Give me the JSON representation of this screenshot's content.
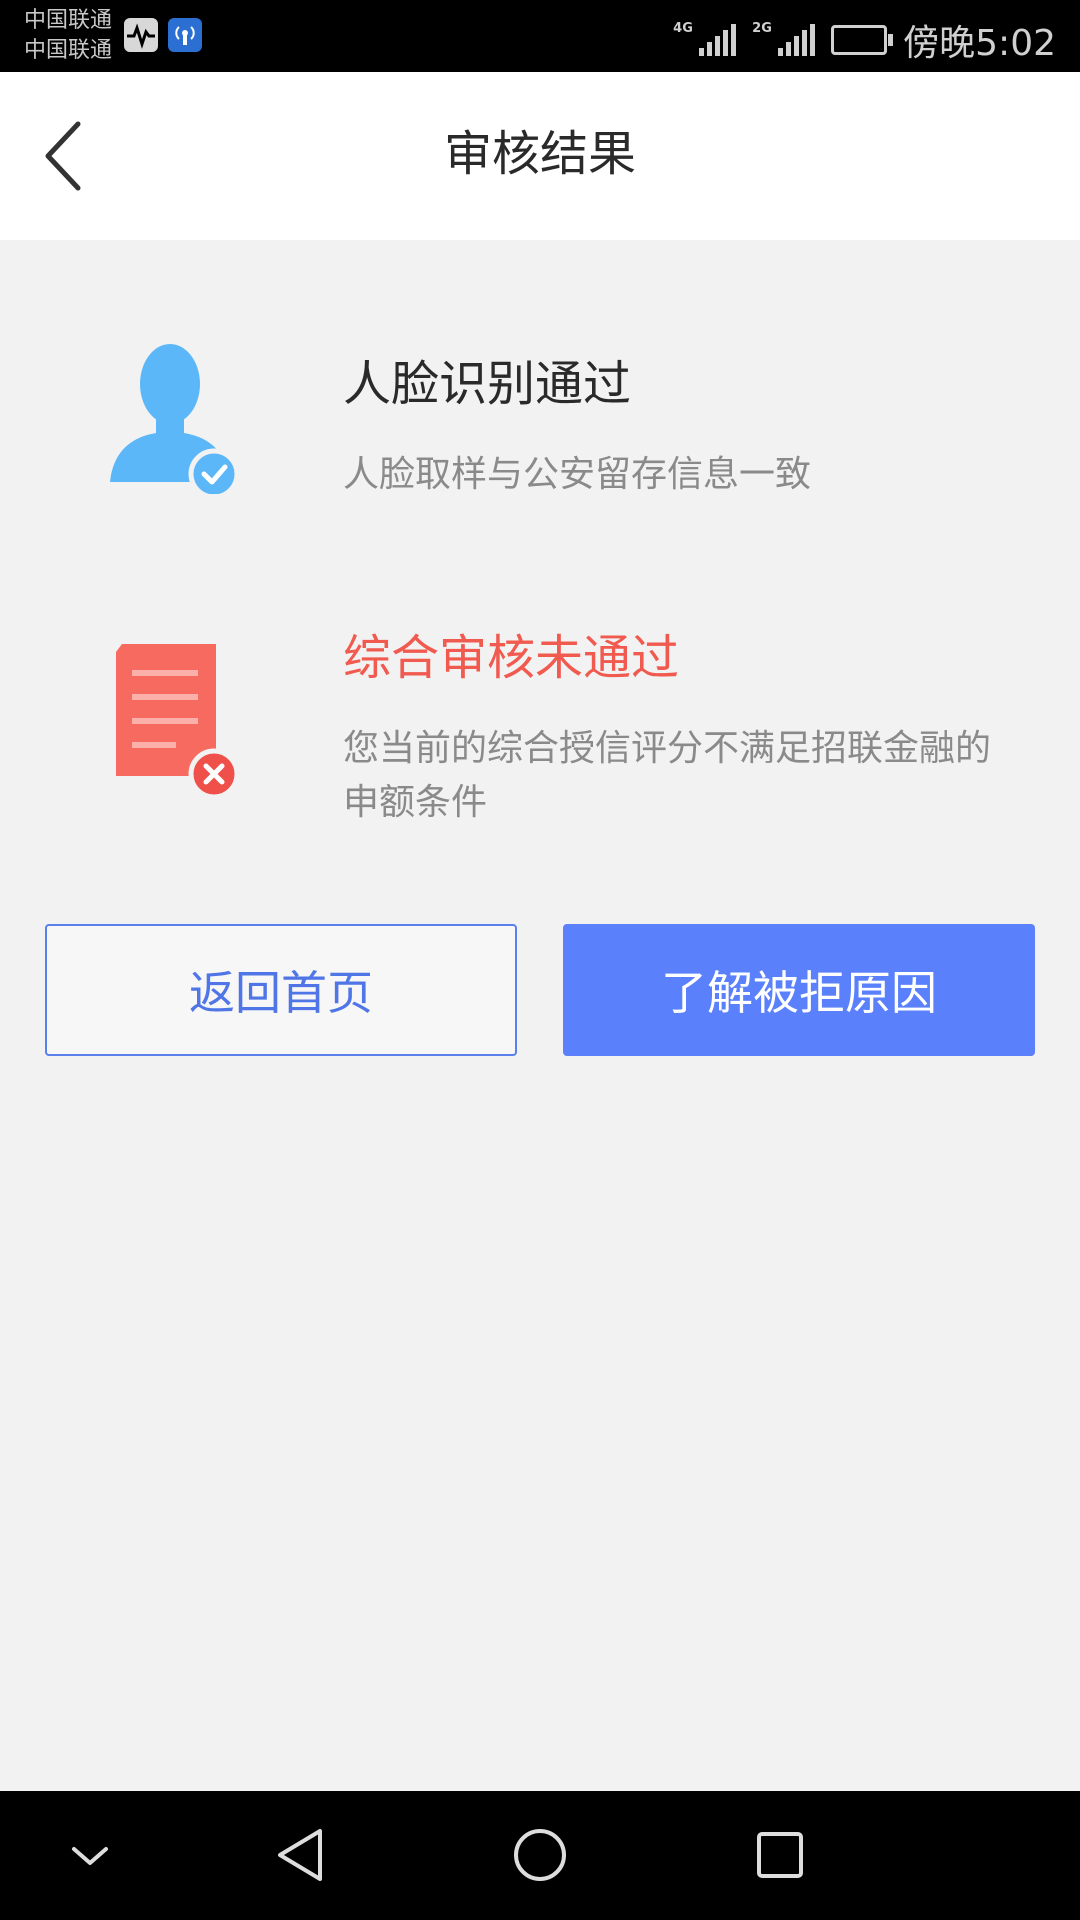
{
  "status_bar": {
    "carrier1": "中国联通",
    "carrier2": "中国联通",
    "signal1_tag": "4G",
    "signal2_tag": "2G",
    "time": "傍晚5:02"
  },
  "header": {
    "title": "审核结果",
    "back_icon": "chevron-left-icon"
  },
  "results": [
    {
      "icon": "user-check-icon",
      "title": "人脸识别通过",
      "title_color": "#2a2a2a",
      "description": "人脸取样与公安留存信息一致"
    },
    {
      "icon": "document-fail-icon",
      "title": "综合审核未通过",
      "title_color": "#f05a4f",
      "description": "您当前的综合授信评分不满足招联金融的申额条件"
    }
  ],
  "buttons": {
    "home": "返回首页",
    "reason": "了解被拒原因"
  },
  "colors": {
    "accent_blue": "#5a80fb",
    "success_blue": "#5cb7f8",
    "error_red": "#f05a4f",
    "background": "#f2f2f2"
  },
  "nav_bar": {
    "items": [
      "chevron-down-icon",
      "back-triangle-icon",
      "home-circle-icon",
      "recents-square-icon"
    ]
  }
}
